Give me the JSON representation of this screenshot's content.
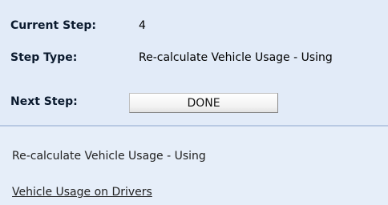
{
  "step_info": {
    "current_step_label": "Current Step:",
    "current_step_value": "4",
    "step_type_label": "Step Type:",
    "step_type_value": "Re-calculate Vehicle Usage - Using",
    "next_step_label": "Next Step:",
    "next_step_button": "DONE"
  },
  "details": {
    "description": "Re-calculate Vehicle Usage - Using",
    "link_text": "Vehicle Usage on Drivers"
  }
}
